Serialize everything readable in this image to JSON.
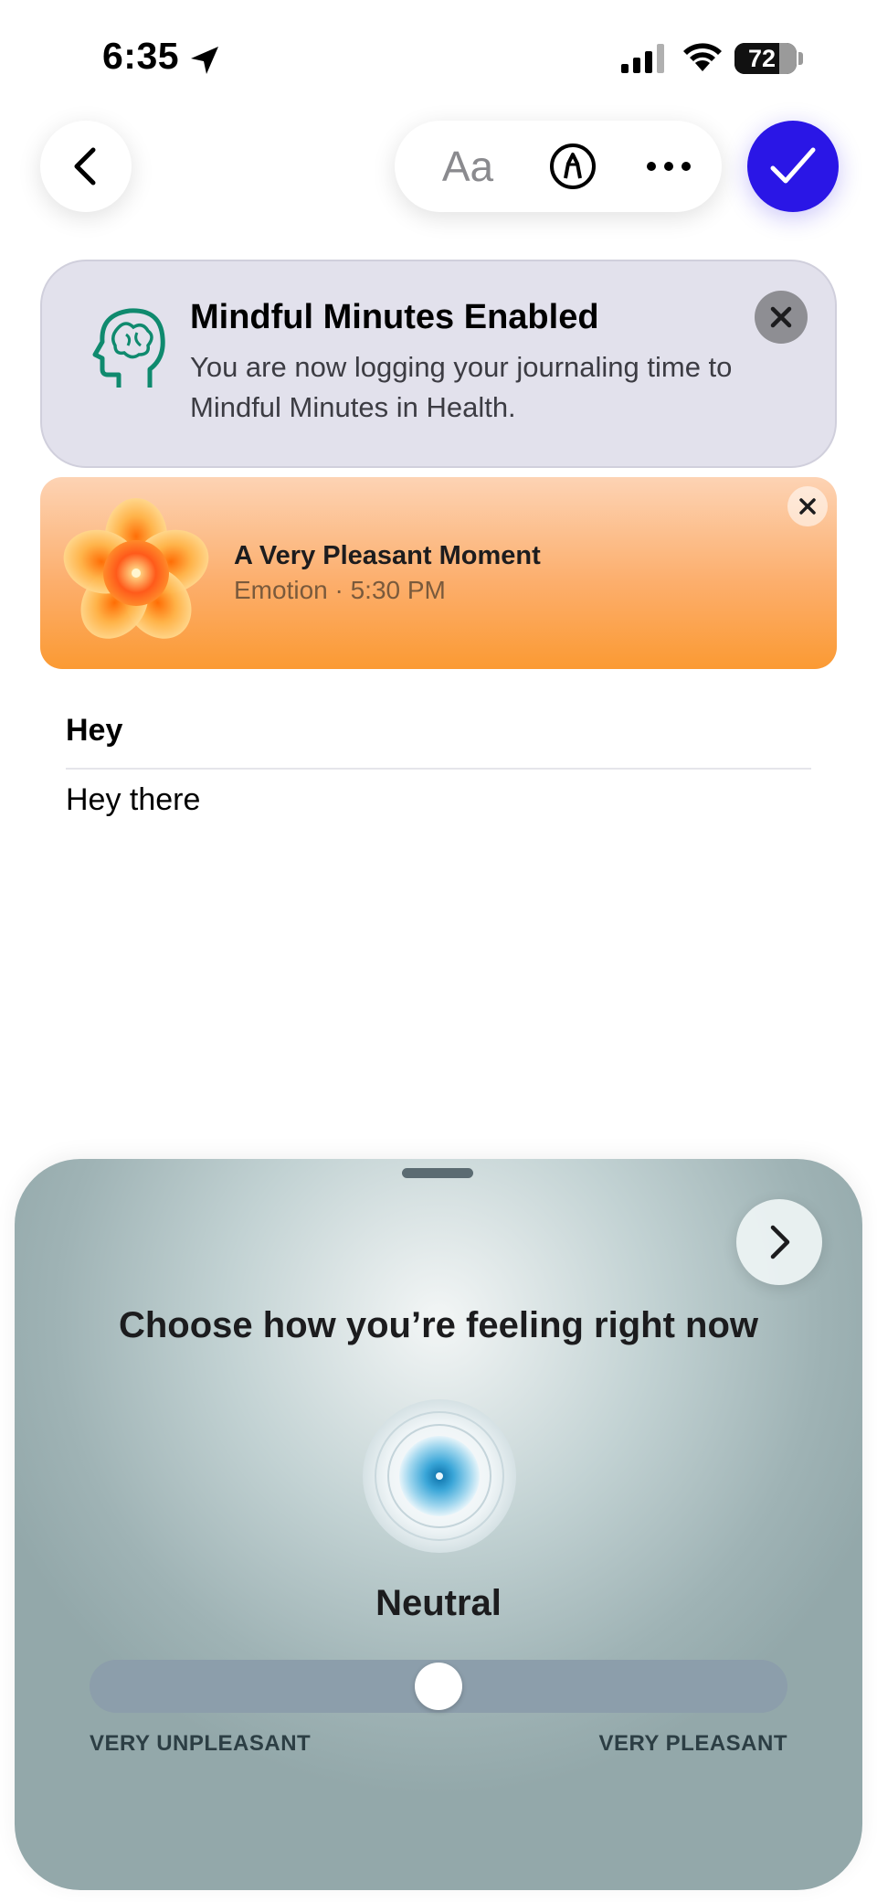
{
  "status_bar": {
    "time": "6:35",
    "battery": "72",
    "battery_level": 0.72,
    "icons": [
      "location-arrow-icon",
      "signal-bars-icon",
      "wifi-icon",
      "battery-icon"
    ]
  },
  "toolbar": {
    "back_icon": "chevron-left-icon",
    "format_label": "Aa",
    "markup_icon": "pen-circle-icon",
    "more_icon": "ellipsis-icon",
    "done_icon": "checkmark-icon",
    "done_color": "#2a16e6"
  },
  "mindful_banner": {
    "icon": "brain-head-icon",
    "title": "Mindful Minutes Enabled",
    "body": "You are now logging your journaling time to Mindful Minutes in Health.",
    "close_icon": "close-icon",
    "accent": "#0f8a6e"
  },
  "emotion_card": {
    "icon": "flower-icon",
    "title": "A Very Pleasant Moment",
    "subtitle": "Emotion · 5:30 PM",
    "close_icon": "close-icon",
    "color": "#fb9a33"
  },
  "entry": {
    "title": "Hey",
    "body": "Hey there"
  },
  "mood_sheet": {
    "next_icon": "chevron-right-icon",
    "prompt": "Choose how you’re feeling right now",
    "orb_icon": "neutral-orb-icon",
    "mood": "Neutral",
    "slider_value": 0.5,
    "min_label": "VERY UNPLEASANT",
    "max_label": "VERY PLEASANT"
  }
}
